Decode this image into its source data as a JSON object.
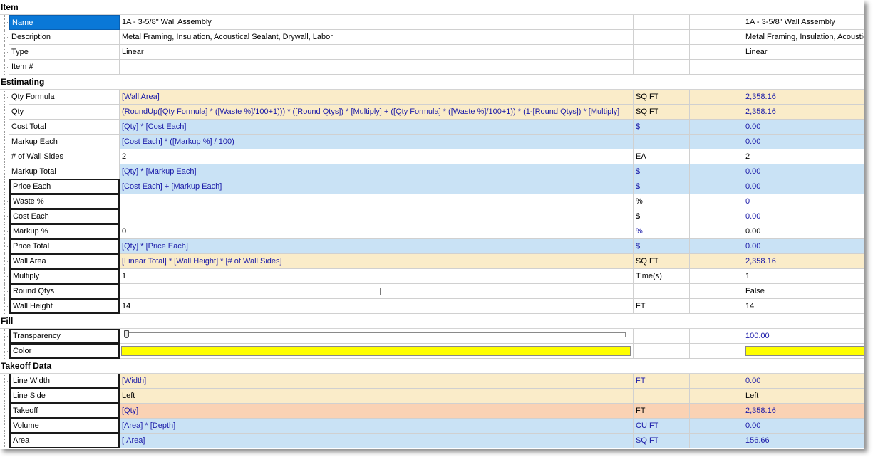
{
  "colors": {
    "selection": "#0a78d7",
    "tan": "#faecc9",
    "blue": "#c9e2f5",
    "orange": "#fad2b4",
    "fill_color": "#ffff00",
    "formula_text": "#1a1aa8"
  },
  "sections": [
    {
      "title": "Item",
      "rows": [
        {
          "label": "Name",
          "value": "1A - 3-5/8\" Wall Assembly",
          "unit": "",
          "ext": "",
          "result": "1A - 3-5/8\" Wall Assembly",
          "bg": "wht",
          "selected": true
        },
        {
          "label": "Description",
          "value": "Metal Framing, Insulation, Acoustical Sealant, Drywall, Labor",
          "unit": "",
          "ext": "",
          "result": "Metal Framing, Insulation, Acoustic",
          "bg": "wht"
        },
        {
          "label": "Type",
          "value": "Linear",
          "unit": "",
          "ext": "",
          "result": "Linear",
          "bg": "wht"
        },
        {
          "label": "Item #",
          "value": "",
          "unit": "",
          "ext": "",
          "result": "",
          "bg": "wht"
        }
      ]
    },
    {
      "title": "Estimating",
      "rows": [
        {
          "label": "Qty Formula",
          "value": "[Wall Area]",
          "unit": "SQ FT",
          "ext": "",
          "result": "2,358.16",
          "bg": "tan",
          "blueVal": true,
          "blueRes": true
        },
        {
          "label": "Qty",
          "value": "(RoundUp([Qty Formula] * ([Waste %]/100+1))) * ([Round Qtys]) * [Multiply] + ([Qty Formula] * ([Waste %]/100+1)) * (1-[Round Qtys]) * [Multiply]",
          "unit": "SQ FT",
          "ext": "",
          "result": "2,358.16",
          "bg": "tan",
          "blueVal": true,
          "blueRes": true
        },
        {
          "label": "Cost Total",
          "value": "[Qty] * [Cost Each]",
          "unit": "$",
          "ext": "",
          "result": "0.00",
          "bg": "blue",
          "blueVal": true,
          "blueUnit": true,
          "blueRes": true
        },
        {
          "label": "Markup Each",
          "value": "[Cost Each] * ([Markup %] / 100)",
          "unit": "",
          "ext": "",
          "result": "0.00",
          "bg": "blue",
          "blueVal": true,
          "blueRes": true
        },
        {
          "label": "# of Wall Sides",
          "value": "2",
          "unit": "EA",
          "ext": "",
          "result": "2",
          "bg": "wht"
        },
        {
          "label": "Markup Total",
          "value": "[Qty] * [Markup Each]",
          "unit": "$",
          "ext": "",
          "result": "0.00",
          "bg": "blue",
          "blueVal": true,
          "blueUnit": true,
          "blueRes": true
        },
        {
          "label": "Price Each",
          "value": "[Cost Each] + [Markup Each]",
          "unit": "$",
          "ext": "",
          "result": "0.00",
          "bg": "blue",
          "blueVal": true,
          "blueUnit": true,
          "blueRes": true,
          "boxed": true
        },
        {
          "label": "Waste %",
          "value": "",
          "unit": "%",
          "ext": "",
          "result": "0",
          "bg": "wht",
          "blueRes": true,
          "boxed": true
        },
        {
          "label": "Cost Each",
          "value": "",
          "unit": "$",
          "ext": "",
          "result": "0.00",
          "bg": "wht",
          "blueRes": true,
          "boxed": true
        },
        {
          "label": "Markup %",
          "value": "0",
          "unit": "%",
          "ext": "",
          "result": "0.00",
          "bg": "wht",
          "blueUnit": true,
          "boxed": true
        },
        {
          "label": "Price Total",
          "value": "[Qty] * [Price Each]",
          "unit": "$",
          "ext": "",
          "result": "0.00",
          "bg": "blue",
          "blueVal": true,
          "blueUnit": true,
          "blueRes": true,
          "boxed": true
        },
        {
          "label": "Wall Area",
          "value": "[Linear Total] * [Wall Height] * [# of Wall Sides]",
          "unit": "SQ FT",
          "ext": "",
          "result": "2,358.16",
          "bg": "tan",
          "blueVal": true,
          "blueRes": true,
          "boxed": true
        },
        {
          "label": "Multiply",
          "value": "1",
          "unit": "Time(s)",
          "ext": "",
          "result": "1",
          "bg": "wht",
          "boxed": true
        },
        {
          "label": "Round Qtys",
          "value": "",
          "unit": "",
          "ext": "",
          "result": "False",
          "bg": "wht",
          "checkbox": true,
          "boxed": true
        },
        {
          "label": "Wall Height",
          "value": "14",
          "unit": "FT",
          "ext": "",
          "result": "14",
          "bg": "wht",
          "boxed": true
        }
      ]
    },
    {
      "title": "Fill",
      "rows": [
        {
          "label": "Transparency",
          "value": "",
          "unit": "",
          "ext": "",
          "result": "100.00",
          "bg": "wht",
          "slider": true,
          "transparency": 0,
          "blueRes": true,
          "boxed": true
        },
        {
          "label": "Color",
          "value": "",
          "unit": "",
          "ext": "",
          "result": "",
          "bg": "wht",
          "swatch": true,
          "boxed": true
        }
      ]
    },
    {
      "title": "Takeoff Data",
      "rows": [
        {
          "label": "Line Width",
          "value": "[Width]",
          "unit": "FT",
          "ext": "",
          "result": "0.00",
          "bg": "tan",
          "blueVal": true,
          "blueUnit": true,
          "blueRes": true,
          "boxed": true
        },
        {
          "label": "Line Side",
          "value": "Left",
          "unit": "",
          "ext": "",
          "result": "Left",
          "bg": "tan",
          "boxed": true
        },
        {
          "label": "Takeoff",
          "value": "[Qty]",
          "unit": "FT",
          "ext": "",
          "result": "2,358.16",
          "bg": "org",
          "blueVal": true,
          "blueRes": true,
          "boxed": true
        },
        {
          "label": "Volume",
          "value": "[Area] * [Depth]",
          "unit": "CU FT",
          "ext": "",
          "result": "0.00",
          "bg": "blue",
          "blueVal": true,
          "blueUnit": true,
          "blueRes": true,
          "boxed": true
        },
        {
          "label": "Area",
          "value": "[!Area]",
          "unit": "SQ FT",
          "ext": "",
          "result": "156.66",
          "bg": "blue",
          "blueVal": true,
          "blueUnit": true,
          "blueRes": true,
          "boxed": true
        }
      ]
    }
  ]
}
